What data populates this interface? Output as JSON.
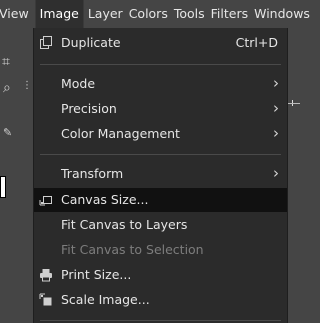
{
  "menubar": {
    "items": [
      {
        "label": "View"
      },
      {
        "label": "Image"
      },
      {
        "label": "Layer"
      },
      {
        "label": "Colors"
      },
      {
        "label": "Tools"
      },
      {
        "label": "Filters"
      },
      {
        "label": "Windows"
      }
    ]
  },
  "image_menu": {
    "duplicate": {
      "label": "Duplicate",
      "accel": "Ctrl+D"
    },
    "mode": {
      "label": "Mode"
    },
    "precision": {
      "label": "Precision"
    },
    "color_management": {
      "label": "Color Management"
    },
    "transform": {
      "label": "Transform"
    },
    "canvas_size": {
      "label": "Canvas Size..."
    },
    "fit_canvas_layers": {
      "label": "Fit Canvas to Layers"
    },
    "fit_canvas_selection": {
      "label": "Fit Canvas to Selection"
    },
    "print_size": {
      "label": "Print Size..."
    },
    "scale_image": {
      "label": "Scale Image..."
    }
  },
  "colors": {
    "highlight": "#111111",
    "menu_bg": "#2b2b2b",
    "disabled": "#7d7d7d"
  }
}
